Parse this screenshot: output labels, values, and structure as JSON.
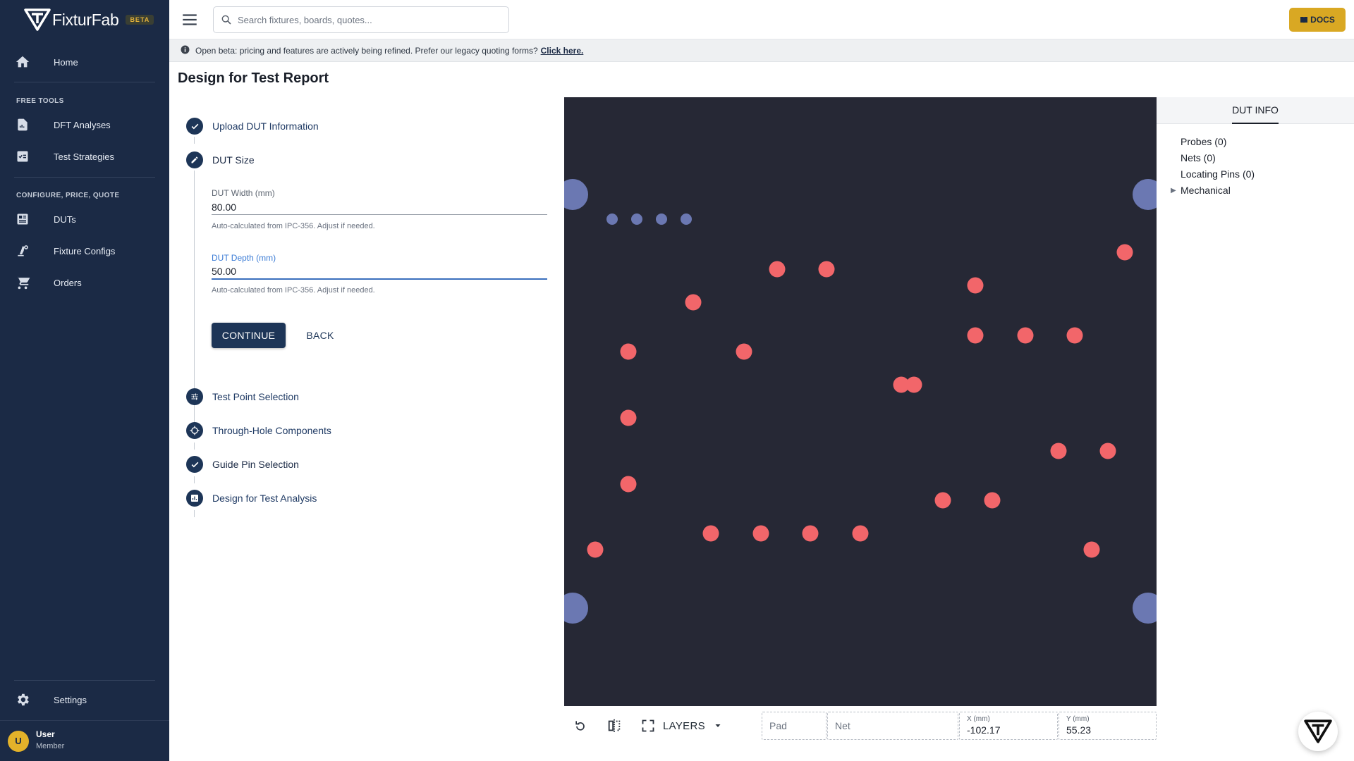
{
  "brand": {
    "name": "FixturFab",
    "badge": "BETA"
  },
  "sidebar": {
    "home": "Home",
    "section_free_tools": "FREE TOOLS",
    "dft_analyses": "DFT Analyses",
    "test_strategies": "Test Strategies",
    "section_configure": "CONFIGURE, PRICE, QUOTE",
    "duts": "DUTs",
    "fixture_configs": "Fixture Configs",
    "orders": "Orders",
    "settings": "Settings",
    "user": {
      "initial": "U",
      "name": "User",
      "role": "Member"
    }
  },
  "topbar": {
    "search_placeholder": "Search fixtures, boards, quotes...",
    "docs_label": "DOCS"
  },
  "banner": {
    "text": "Open beta: pricing and features are actively being refined. Prefer our legacy quoting forms?",
    "link": "Click here."
  },
  "page": {
    "title": "Design for Test Report"
  },
  "steps": [
    {
      "label": "Upload DUT Information",
      "icon": "check-icon"
    },
    {
      "label": "DUT Size",
      "icon": "pencil-icon"
    },
    {
      "label": "Test Point Selection",
      "icon": "tune-icon"
    },
    {
      "label": "Through-Hole Components",
      "icon": "target-icon"
    },
    {
      "label": "Guide Pin Selection",
      "icon": "check-icon"
    },
    {
      "label": "Design for Test Analysis",
      "icon": "chart-icon"
    }
  ],
  "form": {
    "width_label": "DUT Width (mm)",
    "width_value": "80.00",
    "width_help": "Auto-calculated from IPC-356. Adjust if needed.",
    "depth_label": "DUT Depth (mm)",
    "depth_value": "50.00",
    "depth_help": "Auto-calculated from IPC-356. Adjust if needed.",
    "continue": "CONTINUE",
    "back": "BACK"
  },
  "canvas": {
    "colors": {
      "background": "#262835",
      "pad": "#f2666a",
      "pin": "#6b78b2"
    }
  },
  "canvas_toolbar": {
    "layers_label": "LAYERS",
    "pad_placeholder": "Pad",
    "net_placeholder": "Net",
    "x_label": "X (mm)",
    "x_value": "-102.17",
    "y_label": "Y (mm)",
    "y_value": "55.23"
  },
  "dut_info": {
    "tab": "DUT INFO",
    "probes": "Probes (0)",
    "nets": "Nets (0)",
    "locating_pins": "Locating Pins (0)",
    "mechanical": "Mechanical"
  }
}
